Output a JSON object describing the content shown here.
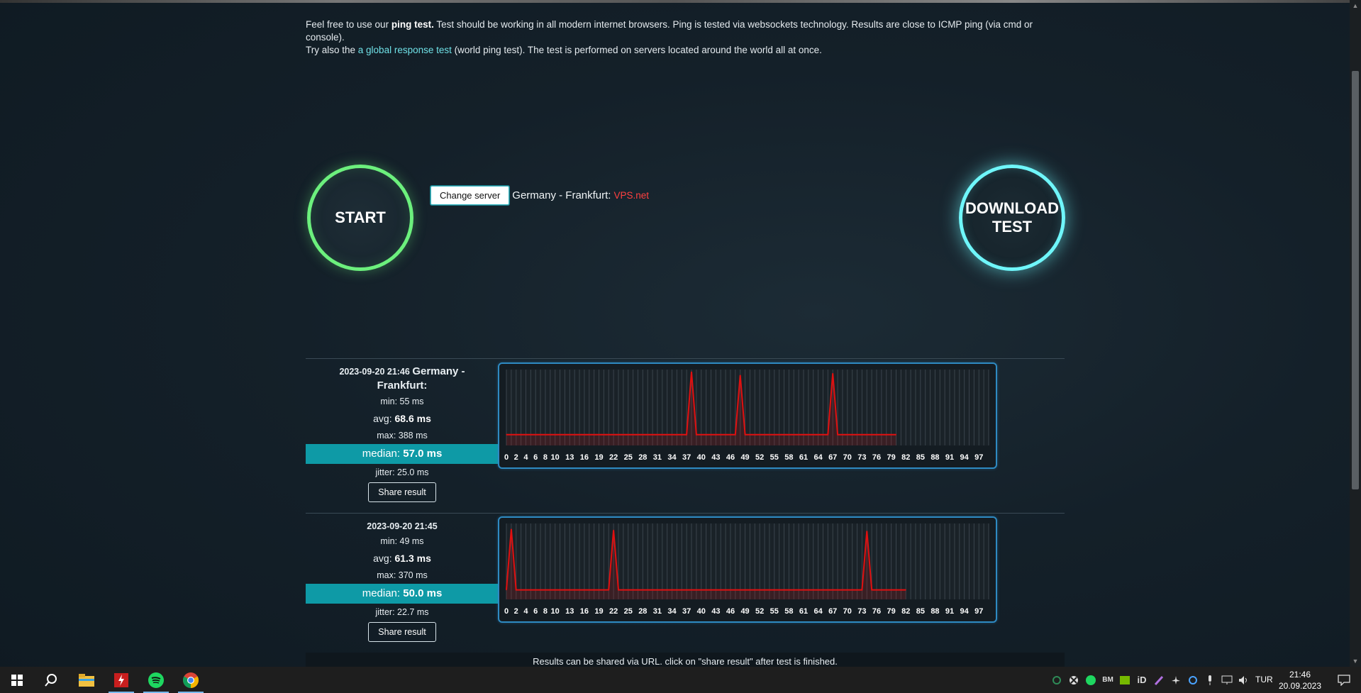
{
  "intro": {
    "p1_pre": "Feel free to use our ",
    "p1_bold": "ping test.",
    "p1_post": " Test should be working in all modern internet browsers. Ping is tested via websockets technology. Results are close to ICMP ping (via cmd or console).",
    "p2_pre": "Try also the ",
    "p2_link": "a global response test",
    "p2_post": " (world ping test). The test is performed on servers located around the world all at once."
  },
  "controls": {
    "start_label": "START",
    "download_label_1": "DOWNLOAD",
    "download_label_2": "TEST",
    "change_server_label": "Change server",
    "server_name": "Germany - Frankfurt:",
    "server_host": "VPS.net"
  },
  "results": [
    {
      "date": "2023-09-20 21:46",
      "location_1": "Germany -",
      "location_2": "Frankfurt:",
      "min_label": "min: ",
      "min_value": "55 ms",
      "avg_label": "avg: ",
      "avg_value": "68.6 ms",
      "max_label": "max: ",
      "max_value": "388 ms",
      "median_label": "median: ",
      "median_value": "57.0 ms",
      "jitter_label": "jitter: ",
      "jitter_value": "25.0 ms",
      "share_label": "Share result"
    },
    {
      "date": "2023-09-20 21:45",
      "min_label": "min: ",
      "min_value": "49 ms",
      "avg_label": "avg: ",
      "avg_value": "61.3 ms",
      "max_label": "max: ",
      "max_value": "370 ms",
      "median_label": "median: ",
      "median_value": "50.0 ms",
      "jitter_label": "jitter: ",
      "jitter_value": "22.7 ms",
      "share_label": "Share result"
    }
  ],
  "chart_data": [
    {
      "type": "line",
      "x_tick_labels": [
        "0",
        "2",
        "4",
        "6",
        "8",
        "10",
        "13",
        "16",
        "19",
        "22",
        "25",
        "28",
        "31",
        "34",
        "37",
        "40",
        "43",
        "46",
        "49",
        "52",
        "55",
        "58",
        "61",
        "64",
        "67",
        "70",
        "73",
        "76",
        "79",
        "82",
        "85",
        "88",
        "91",
        "94",
        "97"
      ],
      "xlim": [
        0,
        99
      ],
      "ylim": [
        0,
        400
      ],
      "grid": true,
      "x": [
        0,
        1,
        2,
        3,
        4,
        5,
        6,
        7,
        8,
        9,
        10,
        11,
        12,
        13,
        14,
        15,
        16,
        17,
        18,
        19,
        20,
        21,
        22,
        23,
        24,
        25,
        26,
        27,
        28,
        29,
        30,
        31,
        32,
        33,
        34,
        35,
        36,
        37,
        38,
        39,
        40,
        41,
        42,
        43,
        44,
        45,
        46,
        47,
        48,
        49,
        50,
        51,
        52,
        53,
        54,
        55,
        56,
        57,
        58,
        59,
        60,
        61,
        62,
        63,
        64,
        65,
        66,
        67,
        68,
        69,
        70,
        71,
        72,
        73,
        74,
        75,
        76,
        77,
        78,
        79,
        80
      ],
      "values": [
        57,
        57,
        57,
        57,
        57,
        57,
        57,
        57,
        57,
        57,
        57,
        57,
        57,
        57,
        57,
        57,
        57,
        57,
        57,
        57,
        57,
        57,
        57,
        57,
        57,
        57,
        57,
        57,
        57,
        57,
        57,
        57,
        57,
        57,
        57,
        57,
        57,
        57,
        388,
        57,
        57,
        57,
        57,
        57,
        57,
        57,
        57,
        57,
        370,
        57,
        57,
        57,
        57,
        57,
        57,
        57,
        57,
        57,
        57,
        57,
        57,
        57,
        57,
        57,
        57,
        57,
        57,
        380,
        57,
        57,
        57,
        57,
        57,
        57,
        57,
        57,
        57,
        57,
        57,
        57,
        57
      ],
      "color": "#e01010"
    },
    {
      "type": "line",
      "x_tick_labels": [
        "0",
        "2",
        "4",
        "6",
        "8",
        "10",
        "13",
        "16",
        "19",
        "22",
        "25",
        "28",
        "31",
        "34",
        "37",
        "40",
        "43",
        "46",
        "49",
        "52",
        "55",
        "58",
        "61",
        "64",
        "67",
        "70",
        "73",
        "76",
        "79",
        "82",
        "85",
        "88",
        "91",
        "94",
        "97"
      ],
      "xlim": [
        0,
        99
      ],
      "ylim": [
        0,
        400
      ],
      "grid": true,
      "x": [
        0,
        1,
        2,
        3,
        4,
        5,
        6,
        7,
        8,
        9,
        10,
        11,
        12,
        13,
        14,
        15,
        16,
        17,
        18,
        19,
        20,
        21,
        22,
        23,
        24,
        25,
        26,
        27,
        28,
        29,
        30,
        31,
        32,
        33,
        34,
        35,
        36,
        37,
        38,
        39,
        40,
        41,
        42,
        43,
        44,
        45,
        46,
        47,
        48,
        49,
        50,
        51,
        52,
        53,
        54,
        55,
        56,
        57,
        58,
        59,
        60,
        61,
        62,
        63,
        64,
        65,
        66,
        67,
        68,
        69,
        70,
        71,
        72,
        73,
        74,
        75,
        76,
        77,
        78,
        79,
        80,
        81,
        82
      ],
      "values": [
        50,
        370,
        50,
        50,
        50,
        50,
        50,
        50,
        50,
        50,
        50,
        50,
        50,
        50,
        50,
        50,
        50,
        50,
        50,
        50,
        50,
        50,
        365,
        50,
        50,
        50,
        50,
        50,
        50,
        50,
        50,
        50,
        50,
        50,
        50,
        50,
        50,
        50,
        50,
        50,
        50,
        50,
        50,
        50,
        50,
        50,
        50,
        50,
        50,
        50,
        50,
        50,
        50,
        50,
        50,
        50,
        50,
        50,
        50,
        50,
        50,
        50,
        50,
        50,
        50,
        50,
        50,
        50,
        50,
        50,
        50,
        50,
        50,
        50,
        360,
        50,
        50,
        50,
        50,
        50,
        50,
        50,
        50
      ],
      "color": "#e01010"
    }
  ],
  "footer": {
    "note": "Results can be shared via URL. click on \"share result\" after test is finished."
  },
  "taskbar": {
    "lang": "TUR",
    "time": "21:46",
    "date": "20.09.2023",
    "tray_bm": "BM",
    "tray_id": "iD"
  }
}
